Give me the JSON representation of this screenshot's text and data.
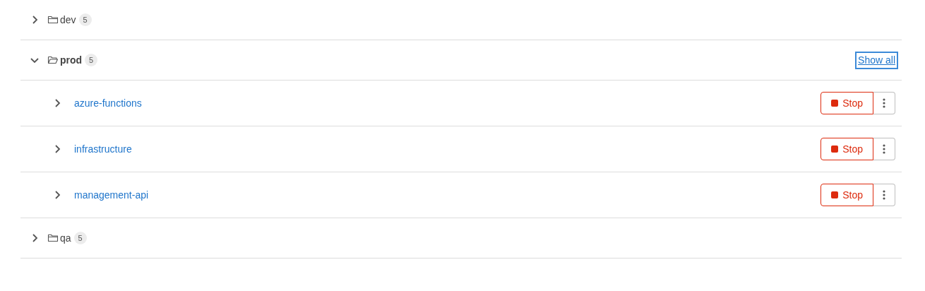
{
  "folders": [
    {
      "name": "dev",
      "count": "5",
      "expanded": false
    },
    {
      "name": "prod",
      "count": "5",
      "expanded": true,
      "show_all": "Show all",
      "children": [
        {
          "name": "azure-functions",
          "expanded": false,
          "action": "Stop"
        },
        {
          "name": "infrastructure",
          "expanded": false,
          "action": "Stop"
        },
        {
          "name": "management-api",
          "expanded": false,
          "action": "Stop"
        }
      ]
    },
    {
      "name": "qa",
      "count": "5",
      "expanded": false
    }
  ]
}
